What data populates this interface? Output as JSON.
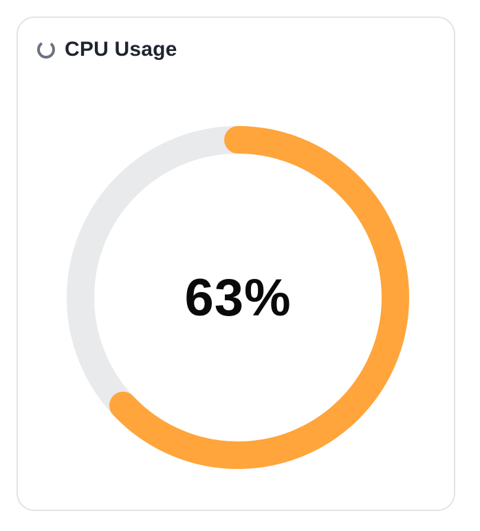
{
  "card": {
    "title": "CPU Usage",
    "icon": "circle-notch-icon"
  },
  "gauge": {
    "value_text": "63%",
    "fraction": 0.63,
    "fill_color": "#ffa53b",
    "track_color": "#e9eaec"
  }
}
